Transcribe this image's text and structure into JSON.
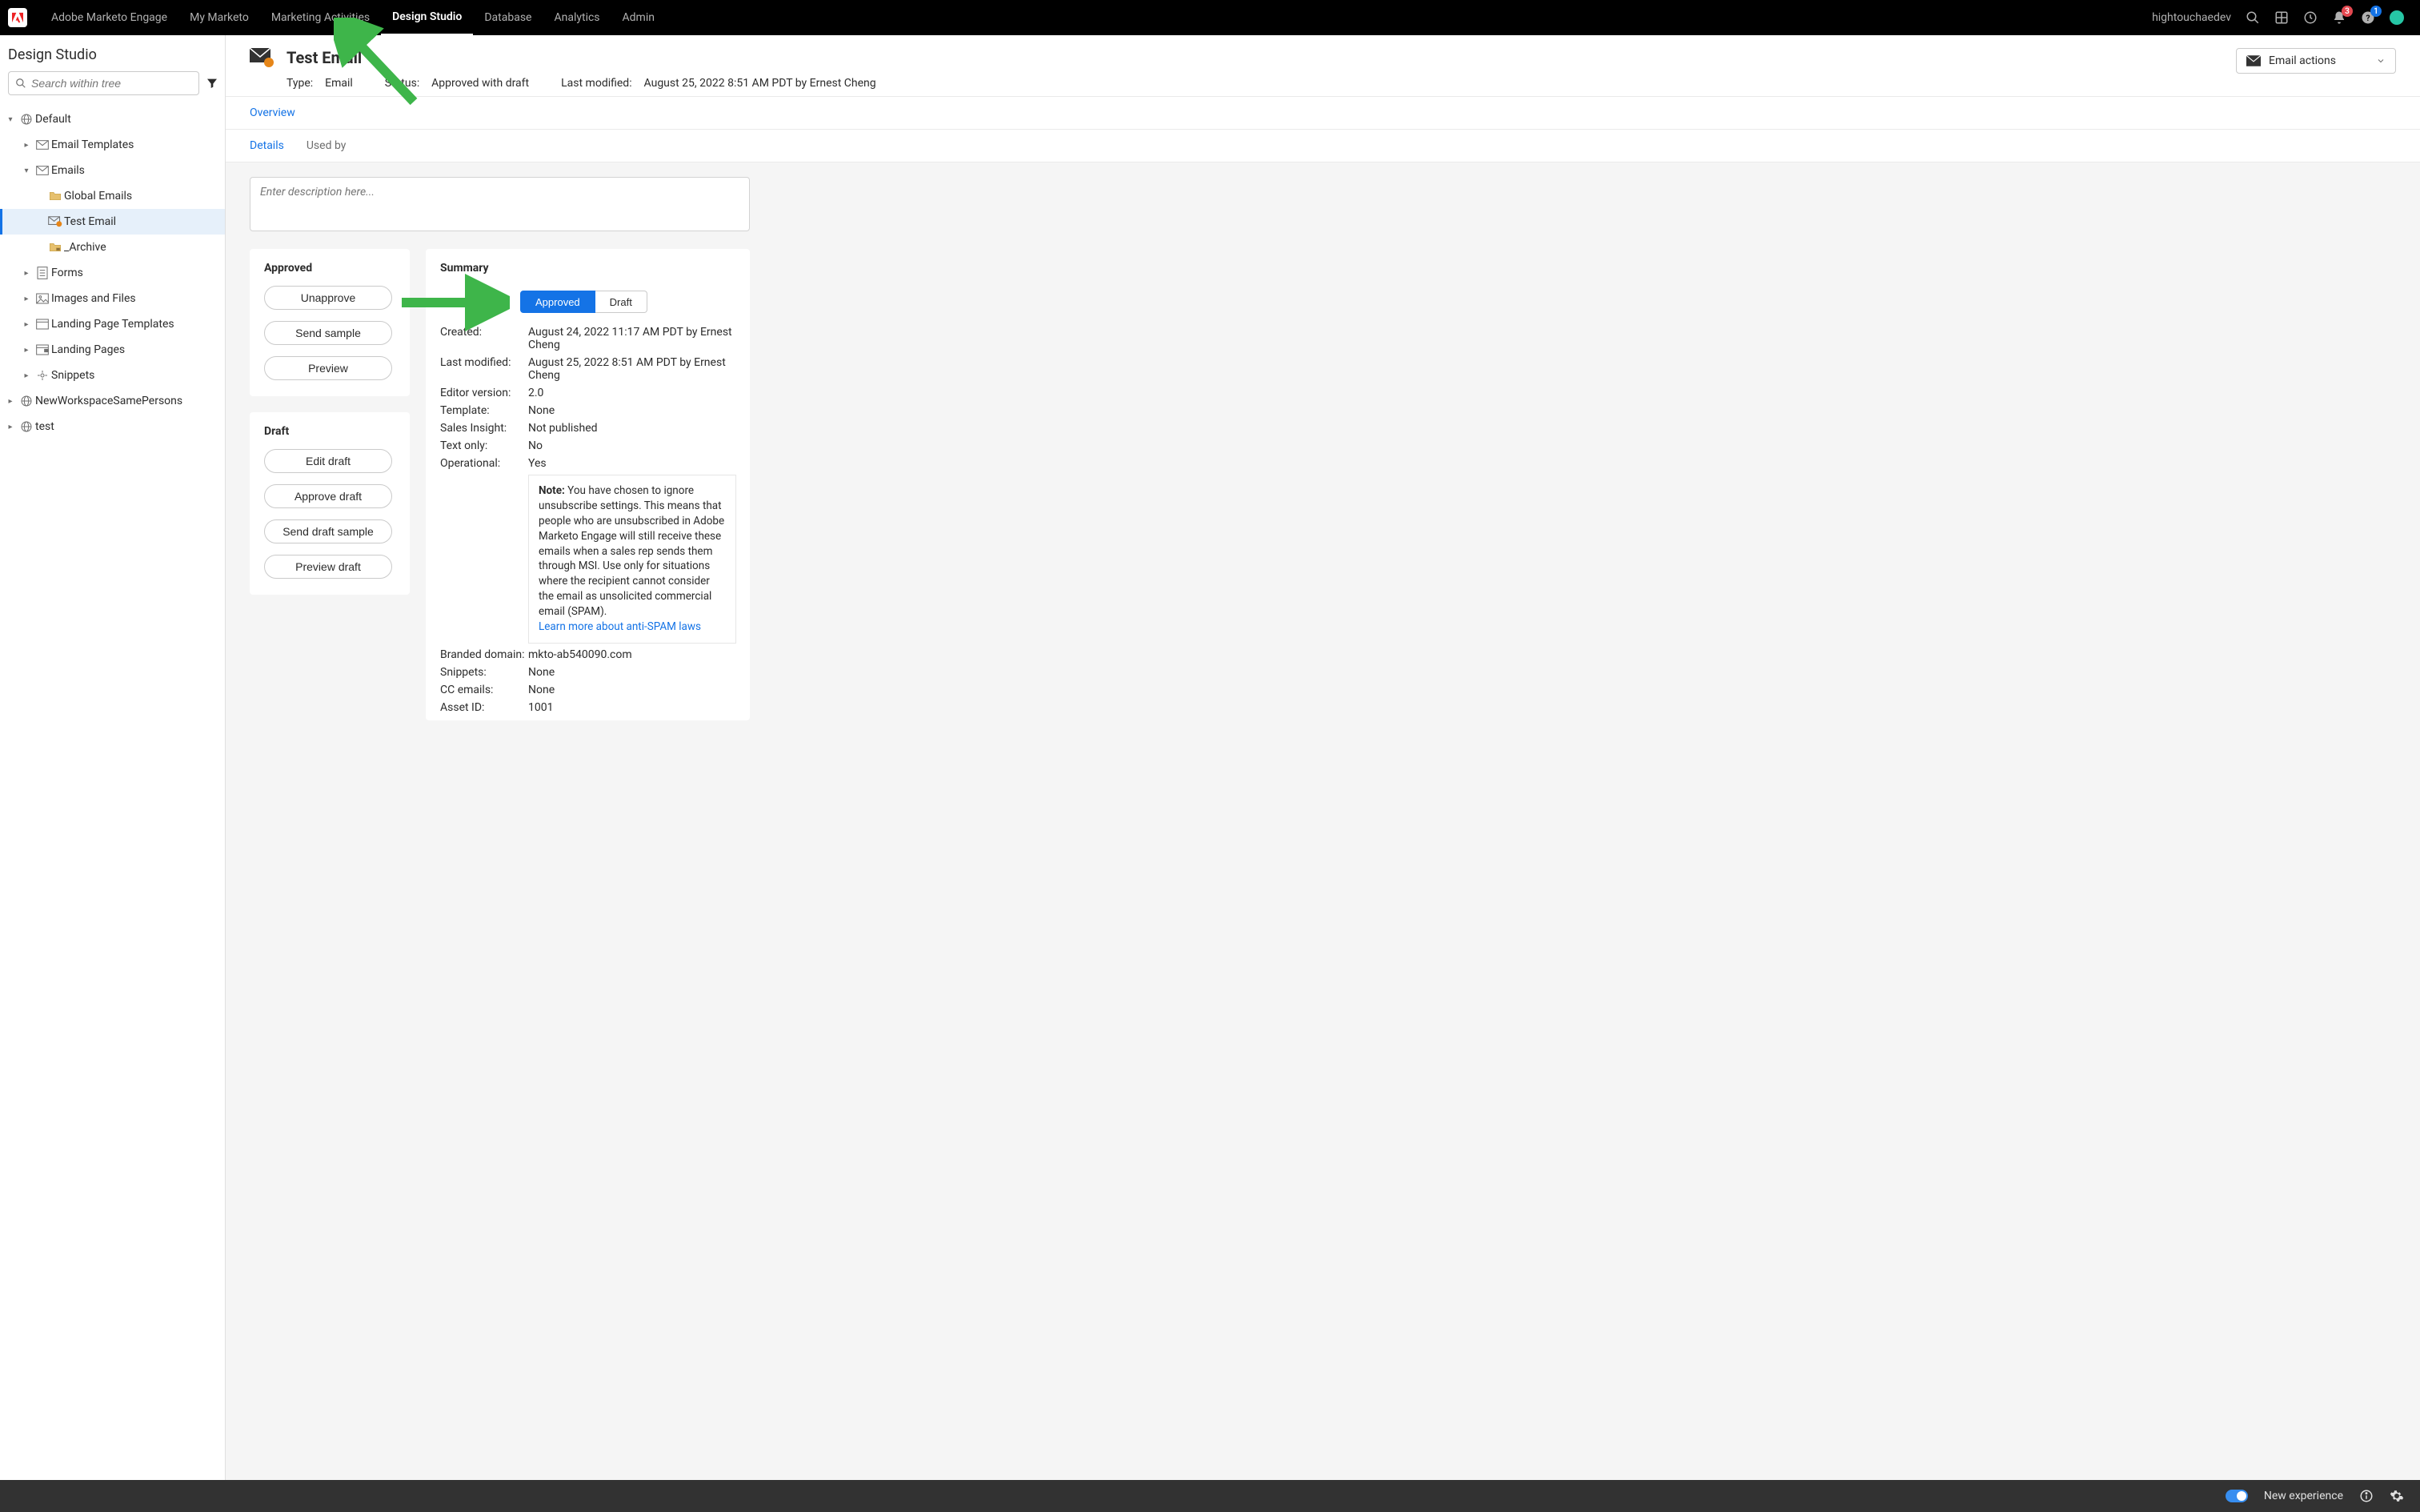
{
  "topnav": {
    "product": "Adobe Marketo Engage",
    "links": [
      "My Marketo",
      "Marketing Activities",
      "Design Studio",
      "Database",
      "Analytics",
      "Admin"
    ],
    "active_index": 2,
    "username": "hightouchaedev",
    "bell_badge": "3",
    "help_badge": "1"
  },
  "sidebar": {
    "title": "Design Studio",
    "search_placeholder": "Search within tree",
    "tree": {
      "default": "Default",
      "email_templates": "Email Templates",
      "emails": "Emails",
      "global_emails": "Global Emails",
      "test_email": "Test Email",
      "archive": "_Archive",
      "forms": "Forms",
      "images_files": "Images and Files",
      "lp_templates": "Landing Page Templates",
      "lp": "Landing Pages",
      "snippets": "Snippets",
      "ws2": "NewWorkspaceSamePersons",
      "ws3": "test"
    }
  },
  "hero": {
    "title": "Test Email",
    "type_label": "Type:",
    "type_value": "Email",
    "status_label": "Status:",
    "status_value": "Approved with draft",
    "lastmod_label": "Last modified:",
    "lastmod_value": "August 25, 2022 8:51 AM PDT by Ernest Cheng",
    "actions_button": "Email actions"
  },
  "tabs": {
    "overview": "Overview"
  },
  "subtabs": {
    "details": "Details",
    "used_by": "Used by"
  },
  "desc_placeholder": "Enter description here...",
  "approved_card": {
    "title": "Approved",
    "unapprove": "Unapprove",
    "send_sample": "Send sample",
    "preview": "Preview"
  },
  "draft_card": {
    "title": "Draft",
    "edit": "Edit draft",
    "approve": "Approve draft",
    "send_sample": "Send draft sample",
    "preview": "Preview draft"
  },
  "summary": {
    "title": "Summary",
    "seg_approved": "Approved",
    "seg_draft": "Draft",
    "created_k": "Created:",
    "created_v": "August 24, 2022 11:17 AM PDT by Ernest Cheng",
    "lastmod_k": "Last modified:",
    "lastmod_v": "August 25, 2022 8:51 AM PDT by Ernest Cheng",
    "editor_k": "Editor version:",
    "editor_v": "2.0",
    "template_k": "Template:",
    "template_v": "None",
    "sales_k": "Sales Insight:",
    "sales_v": "Not published",
    "textonly_k": "Text only:",
    "textonly_v": "No",
    "operational_k": "Operational:",
    "operational_v": "Yes",
    "note_label": "Note:",
    "note_body": "You have chosen to ignore unsubscribe settings. This means that people who are unsubscribed in Adobe Marketo Engage will still receive these emails when a sales rep sends them through MSI. Use only for situations where the recipient cannot consider the email as unsolicited commercial email (SPAM).",
    "note_link": "Learn more about anti-SPAM laws",
    "branded_k": "Branded domain:",
    "branded_v": "mkto-ab540090.com",
    "snippets_k": "Snippets:",
    "snippets_v": "None",
    "cc_k": "CC emails:",
    "cc_v": "None",
    "asset_k": "Asset ID:",
    "asset_v": "1001"
  },
  "bottombar": {
    "label": "New experience"
  }
}
